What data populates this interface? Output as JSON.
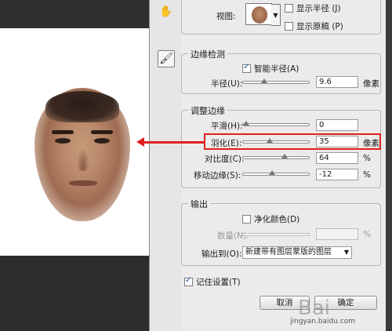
{
  "view": {
    "label": "视图:",
    "show_radius": "显示半径 (J)",
    "show_original": "显示原稿 (P)"
  },
  "edge_detection": {
    "title": "边缘检测",
    "smart_radius": "智能半径(A)",
    "radius_label": "半径(U):",
    "radius_value": "9.6",
    "radius_unit": "像素",
    "radius_level": 0.3
  },
  "adjust_edge": {
    "title": "调整边缘",
    "smooth_label": "平滑(H):",
    "smooth_value": "0",
    "smooth_level": 0.0,
    "feather_label": "羽化(E):",
    "feather_value": "35",
    "feather_unit": "像素",
    "feather_level": 0.4,
    "contrast_label": "对比度(C):",
    "contrast_value": "64",
    "contrast_unit": "%",
    "contrast_level": 0.64,
    "shift_label": "移动边缘(S):",
    "shift_value": "-12",
    "shift_unit": "%",
    "shift_level": 0.44
  },
  "output": {
    "title": "输出",
    "decontaminate": "净化颜色(D)",
    "amount_label": "数量(N):",
    "amount_unit": "%",
    "output_to_label": "输出到(O):",
    "output_to_value": "新建带有图层蒙版的图层"
  },
  "remember": "记住设置(T)",
  "buttons": {
    "cancel": "取消",
    "ok": "确定"
  },
  "watermark": {
    "site": "jingyan.baidu.com",
    "logo": "Bai"
  },
  "colors": {
    "highlight": "#e02020",
    "arrow": "#e02020"
  }
}
